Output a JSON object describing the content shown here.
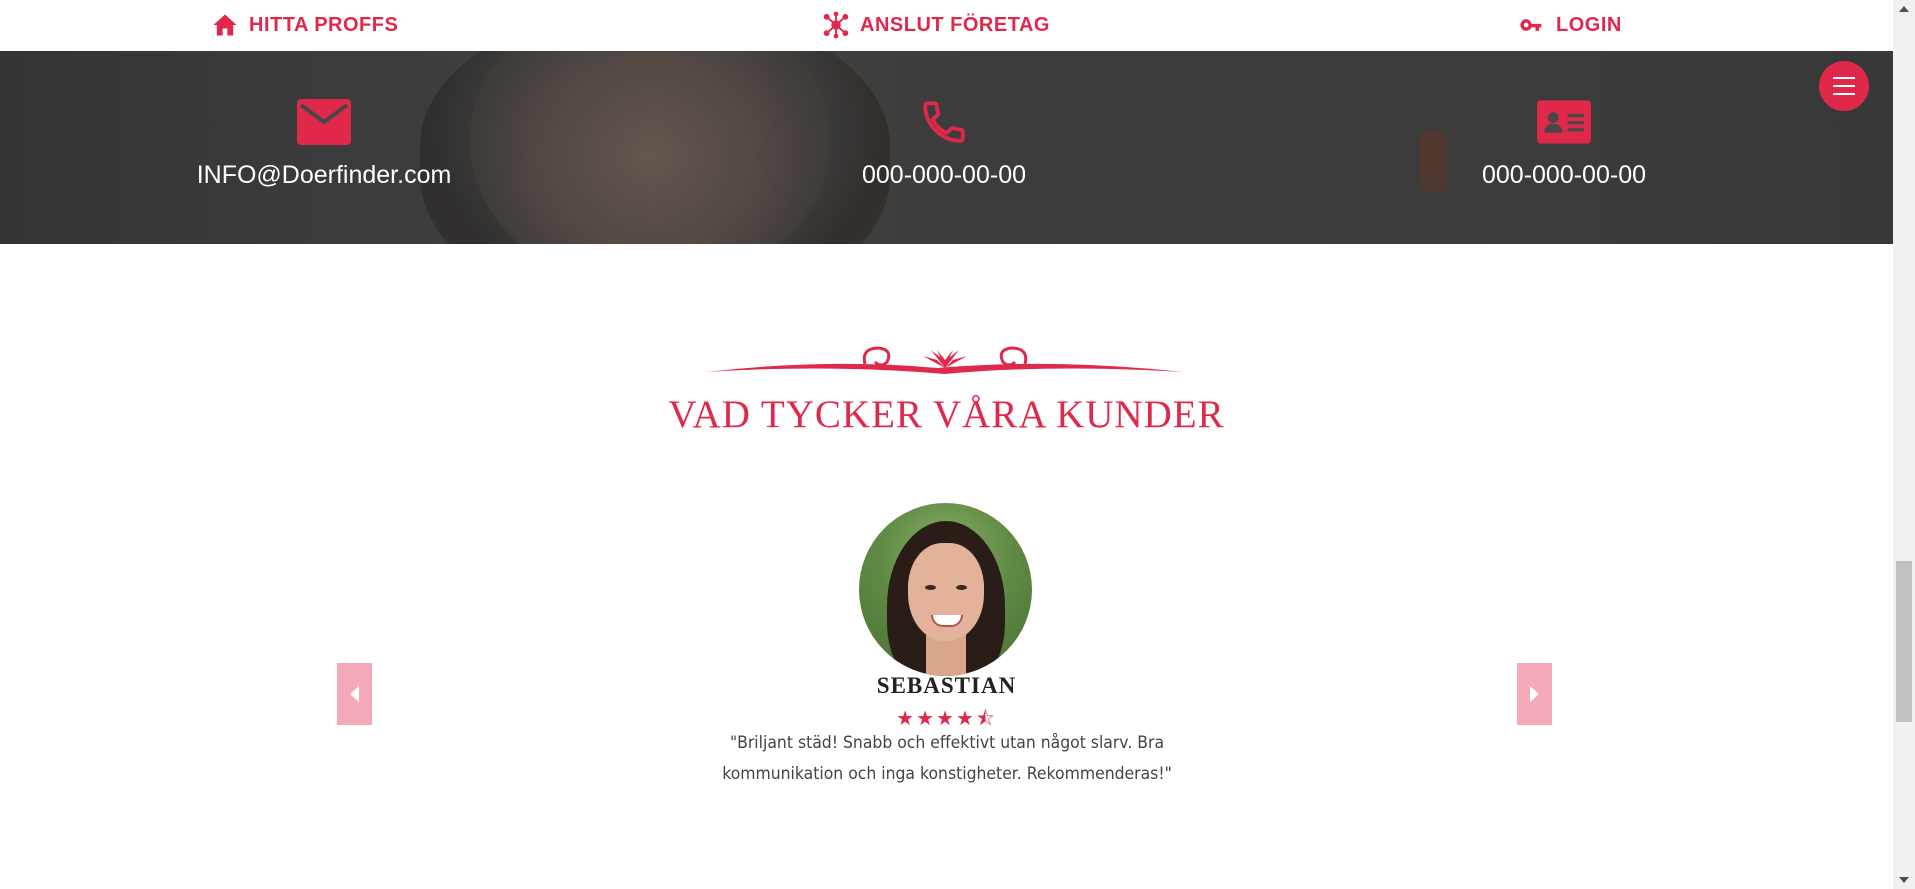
{
  "nav": {
    "items": [
      {
        "label": "HITTA PROFFS",
        "icon": "home-icon"
      },
      {
        "label": "ANSLUT FÖRETAG",
        "icon": "network-icon"
      },
      {
        "label": "LOGIN",
        "icon": "key-icon"
      }
    ]
  },
  "contact": {
    "email": {
      "value": "INFO@Doerfinder.com",
      "icon": "mail-icon"
    },
    "phone": {
      "value": "000-000-00-00",
      "icon": "phone-icon"
    },
    "card": {
      "value": "000-000-00-00",
      "icon": "id-card-icon"
    }
  },
  "menu": {
    "icon": "hamburger-menu-icon"
  },
  "testimonials": {
    "title": "VAD TYCKER VÅRA KUNDER",
    "current": {
      "name": "SEBASTIAN",
      "rating": 4.5,
      "stars": "★★★★⯪",
      "quote": "\"Briljant städ! Snabb och effektivt utan något slarv. Bra kommunikation och inga konstigheter. Rekommenderas!\""
    }
  },
  "colors": {
    "accent": "#e0284b",
    "arrow_bg": "#f3a9b7",
    "banner_bg": "#404040"
  }
}
